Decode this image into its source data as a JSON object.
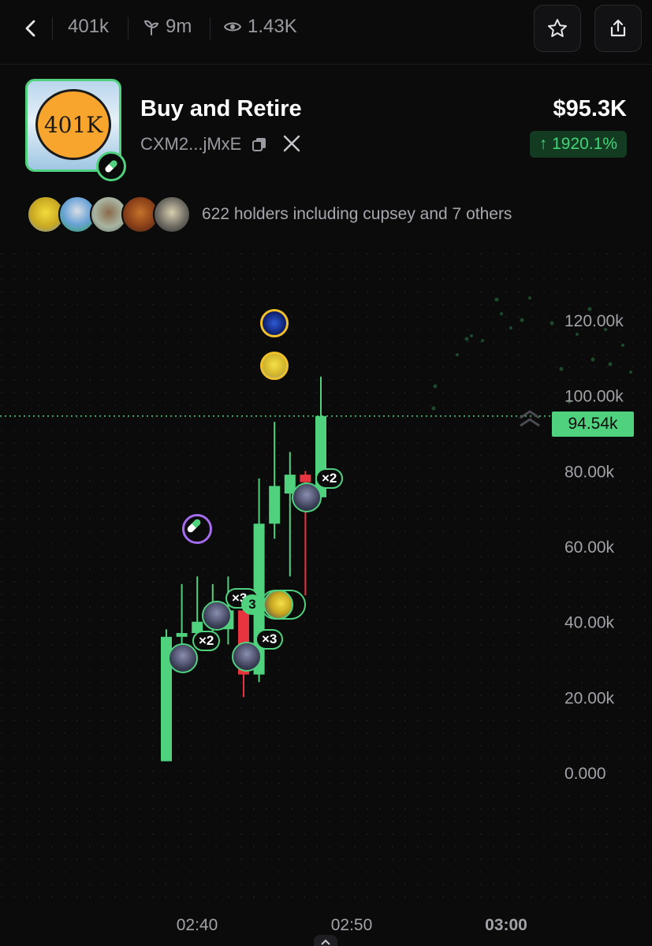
{
  "topbar": {
    "ticker": "401k",
    "age": "9m",
    "views": "1.43K",
    "icons": {
      "back": "chevron-left-icon",
      "age": "sprout-icon",
      "views": "eye-icon",
      "favorite": "star-icon",
      "share": "share-icon"
    }
  },
  "token": {
    "logo_text": "401K",
    "name": "Buy and Retire",
    "address": "CXM2...jMxE",
    "market_cap": "$95.3K",
    "change": "↑ 1920.1%"
  },
  "holders": {
    "text": "622 holders including cupsey and 7 others"
  },
  "chart": {
    "current_price_label": "94.54k",
    "y_ticks": [
      "120.00k",
      "100.00k",
      "80.00k",
      "60.00k",
      "40.00k",
      "20.00k",
      "0.000"
    ],
    "x_ticks": [
      "02:40",
      "02:50",
      "03:00"
    ],
    "multipliers": [
      "×2",
      "×2",
      "×3",
      "×3",
      "×2"
    ]
  },
  "chart_data": {
    "type": "candlestick",
    "x_ticks": [
      "02:40",
      "02:50",
      "03:00"
    ],
    "y_ticks": [
      0,
      20000,
      40000,
      60000,
      80000,
      100000,
      120000
    ],
    "ylim": [
      0,
      125000
    ],
    "current_price": 94540,
    "candles": [
      {
        "open": 3000,
        "high": 38000,
        "low": 3000,
        "close": 36000,
        "dir": "up"
      },
      {
        "open": 36000,
        "high": 50000,
        "low": 34000,
        "close": 37000,
        "dir": "up"
      },
      {
        "open": 37000,
        "high": 52000,
        "low": 33000,
        "close": 40000,
        "dir": "up"
      },
      {
        "open": 40000,
        "high": 50000,
        "low": 33000,
        "close": 43000,
        "dir": "up"
      },
      {
        "open": 38000,
        "high": 52000,
        "low": 34000,
        "close": 43000,
        "dir": "up"
      },
      {
        "open": 43000,
        "high": 46000,
        "low": 20000,
        "close": 26000,
        "dir": "down"
      },
      {
        "open": 26000,
        "high": 78000,
        "low": 24000,
        "close": 66000,
        "dir": "up"
      },
      {
        "open": 66000,
        "high": 93000,
        "low": 62000,
        "close": 76000,
        "dir": "up"
      },
      {
        "open": 74000,
        "high": 85000,
        "low": 52000,
        "close": 79000,
        "dir": "up"
      },
      {
        "open": 79000,
        "high": 80000,
        "low": 47000,
        "close": 77000,
        "dir": "down"
      },
      {
        "open": 73000,
        "high": 105000,
        "low": 73000,
        "close": 94540,
        "dir": "up"
      }
    ]
  },
  "colors": {
    "up": "#4fd17d",
    "down": "#e8343f",
    "accent": "#4fd17d",
    "background": "#0b0b0c"
  }
}
